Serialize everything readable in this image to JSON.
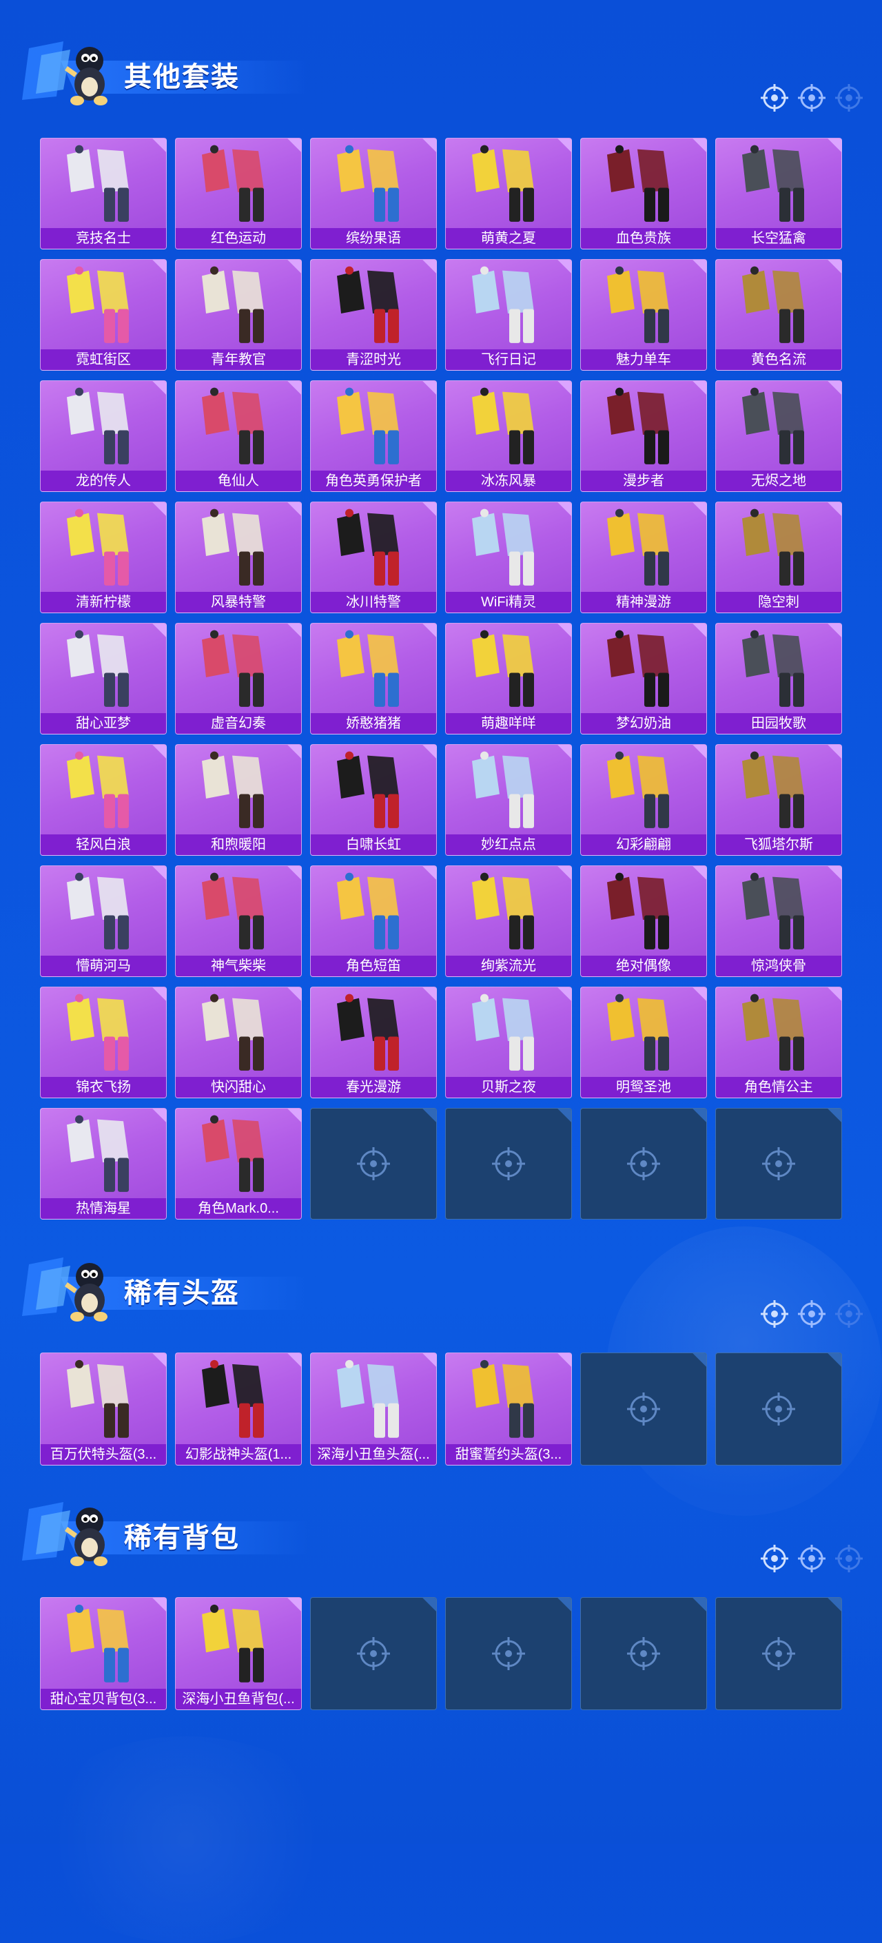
{
  "colors": {
    "background": "#0b55de",
    "card_purple": "#b35ee8",
    "label_bar": "#7f1fd0",
    "empty_slot": "#1c4170"
  },
  "sections": [
    {
      "title": "其他套装",
      "items": [
        "竞技名士",
        "红色运动",
        "缤纷果语",
        "萌黄之夏",
        "血色贵族",
        "长空猛禽",
        "霓虹街区",
        "青年教官",
        "青涩时光",
        "飞行日记",
        "魅力单车",
        "黄色名流",
        "龙的传人",
        "龟仙人",
        "角色英勇保护者",
        "冰冻风暴",
        "漫步者",
        "无烬之地",
        "清新柠檬",
        "风暴特警",
        "冰川特警",
        "WiFi精灵",
        "精神漫游",
        "隐空刺",
        "甜心亚梦",
        "虚音幻奏",
        "娇憨猪猪",
        "萌趣咩咩",
        "梦幻奶油",
        "田园牧歌",
        "轻风白浪",
        "和煦暖阳",
        "白啸长虹",
        "妙红点点",
        "幻彩翩翩",
        "飞狐塔尔斯",
        "懵萌河马",
        "神气柴柴",
        "角色短笛",
        "绚紫流光",
        "绝对偶像",
        "惊鸿侠骨",
        "锦衣飞扬",
        "快闪甜心",
        "春光漫游",
        "贝斯之夜",
        "明鸳圣池",
        "角色情公主",
        "热情海星",
        "角色Mark.0..."
      ],
      "empty_slots": 4
    },
    {
      "title": "稀有头盔",
      "items": [
        "百万伏特头盔(3...",
        "幻影战神头盔(1...",
        "深海小丑鱼头盔(...",
        "甜蜜誓约头盔(3..."
      ],
      "empty_slots": 2
    },
    {
      "title": "稀有背包",
      "items": [
        "甜心宝贝背包(3...",
        "深海小丑鱼背包(..."
      ],
      "empty_slots": 4
    }
  ]
}
